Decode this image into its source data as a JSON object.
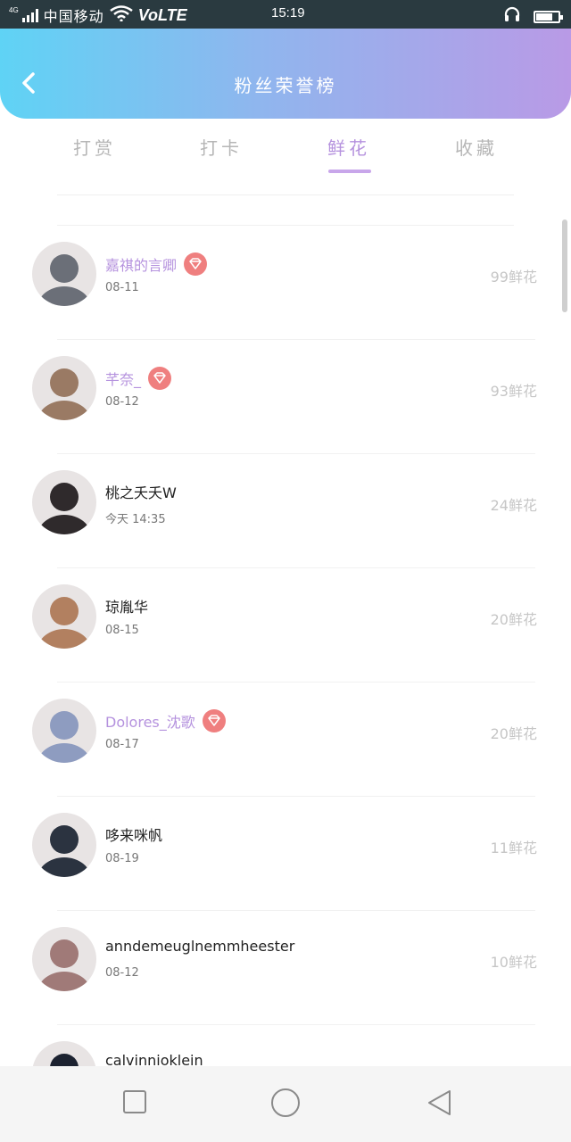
{
  "status_bar": {
    "network": "4G",
    "carrier": "中国移动",
    "volte": "VoLTE",
    "time": "15:19"
  },
  "header": {
    "title": "粉丝荣誉榜"
  },
  "tabs": [
    {
      "label": "打赏"
    },
    {
      "label": "打卡"
    },
    {
      "label": "鲜花"
    },
    {
      "label": "收藏"
    }
  ],
  "active_tab_index": 2,
  "fans": [
    {
      "name": "嘉祺的言卿",
      "date": "08-11",
      "count": "99鲜花",
      "vip": true,
      "avatar_color": "#6b6f78"
    },
    {
      "name": "芊奈_",
      "date": "08-12",
      "count": "93鲜花",
      "vip": true,
      "avatar_color": "#9a7a64"
    },
    {
      "name": "桃之夭夭W",
      "date": "今天 14:35",
      "count": "24鲜花",
      "vip": false,
      "avatar_color": "#2f2a2c"
    },
    {
      "name": "琼胤华",
      "date": "08-15",
      "count": "20鲜花",
      "vip": false,
      "avatar_color": "#b28060"
    },
    {
      "name": "Dolores_沈歌",
      "date": "08-17",
      "count": "20鲜花",
      "vip": true,
      "avatar_color": "#8e9cc0"
    },
    {
      "name": "哆来咪帆",
      "date": "08-19",
      "count": "11鲜花",
      "vip": false,
      "avatar_color": "#2b3340"
    },
    {
      "name": "anndemeuglnemmheester",
      "date": "08-12",
      "count": "10鲜花",
      "vip": false,
      "avatar_color": "#a07a78"
    },
    {
      "name": "calvinnioklein",
      "date": "",
      "count": "",
      "vip": false,
      "avatar_color": "#1c2230"
    }
  ],
  "colors": {
    "accent": "#b592de",
    "badge": "#ef7f7f",
    "header_gradient_start": "#5fd3f5",
    "header_gradient_end": "#b99ae6"
  },
  "icons": {
    "back": "chevron-left-icon",
    "badge": "diamond-icon",
    "nav": [
      "square-icon",
      "circle-icon",
      "triangle-back-icon"
    ]
  }
}
